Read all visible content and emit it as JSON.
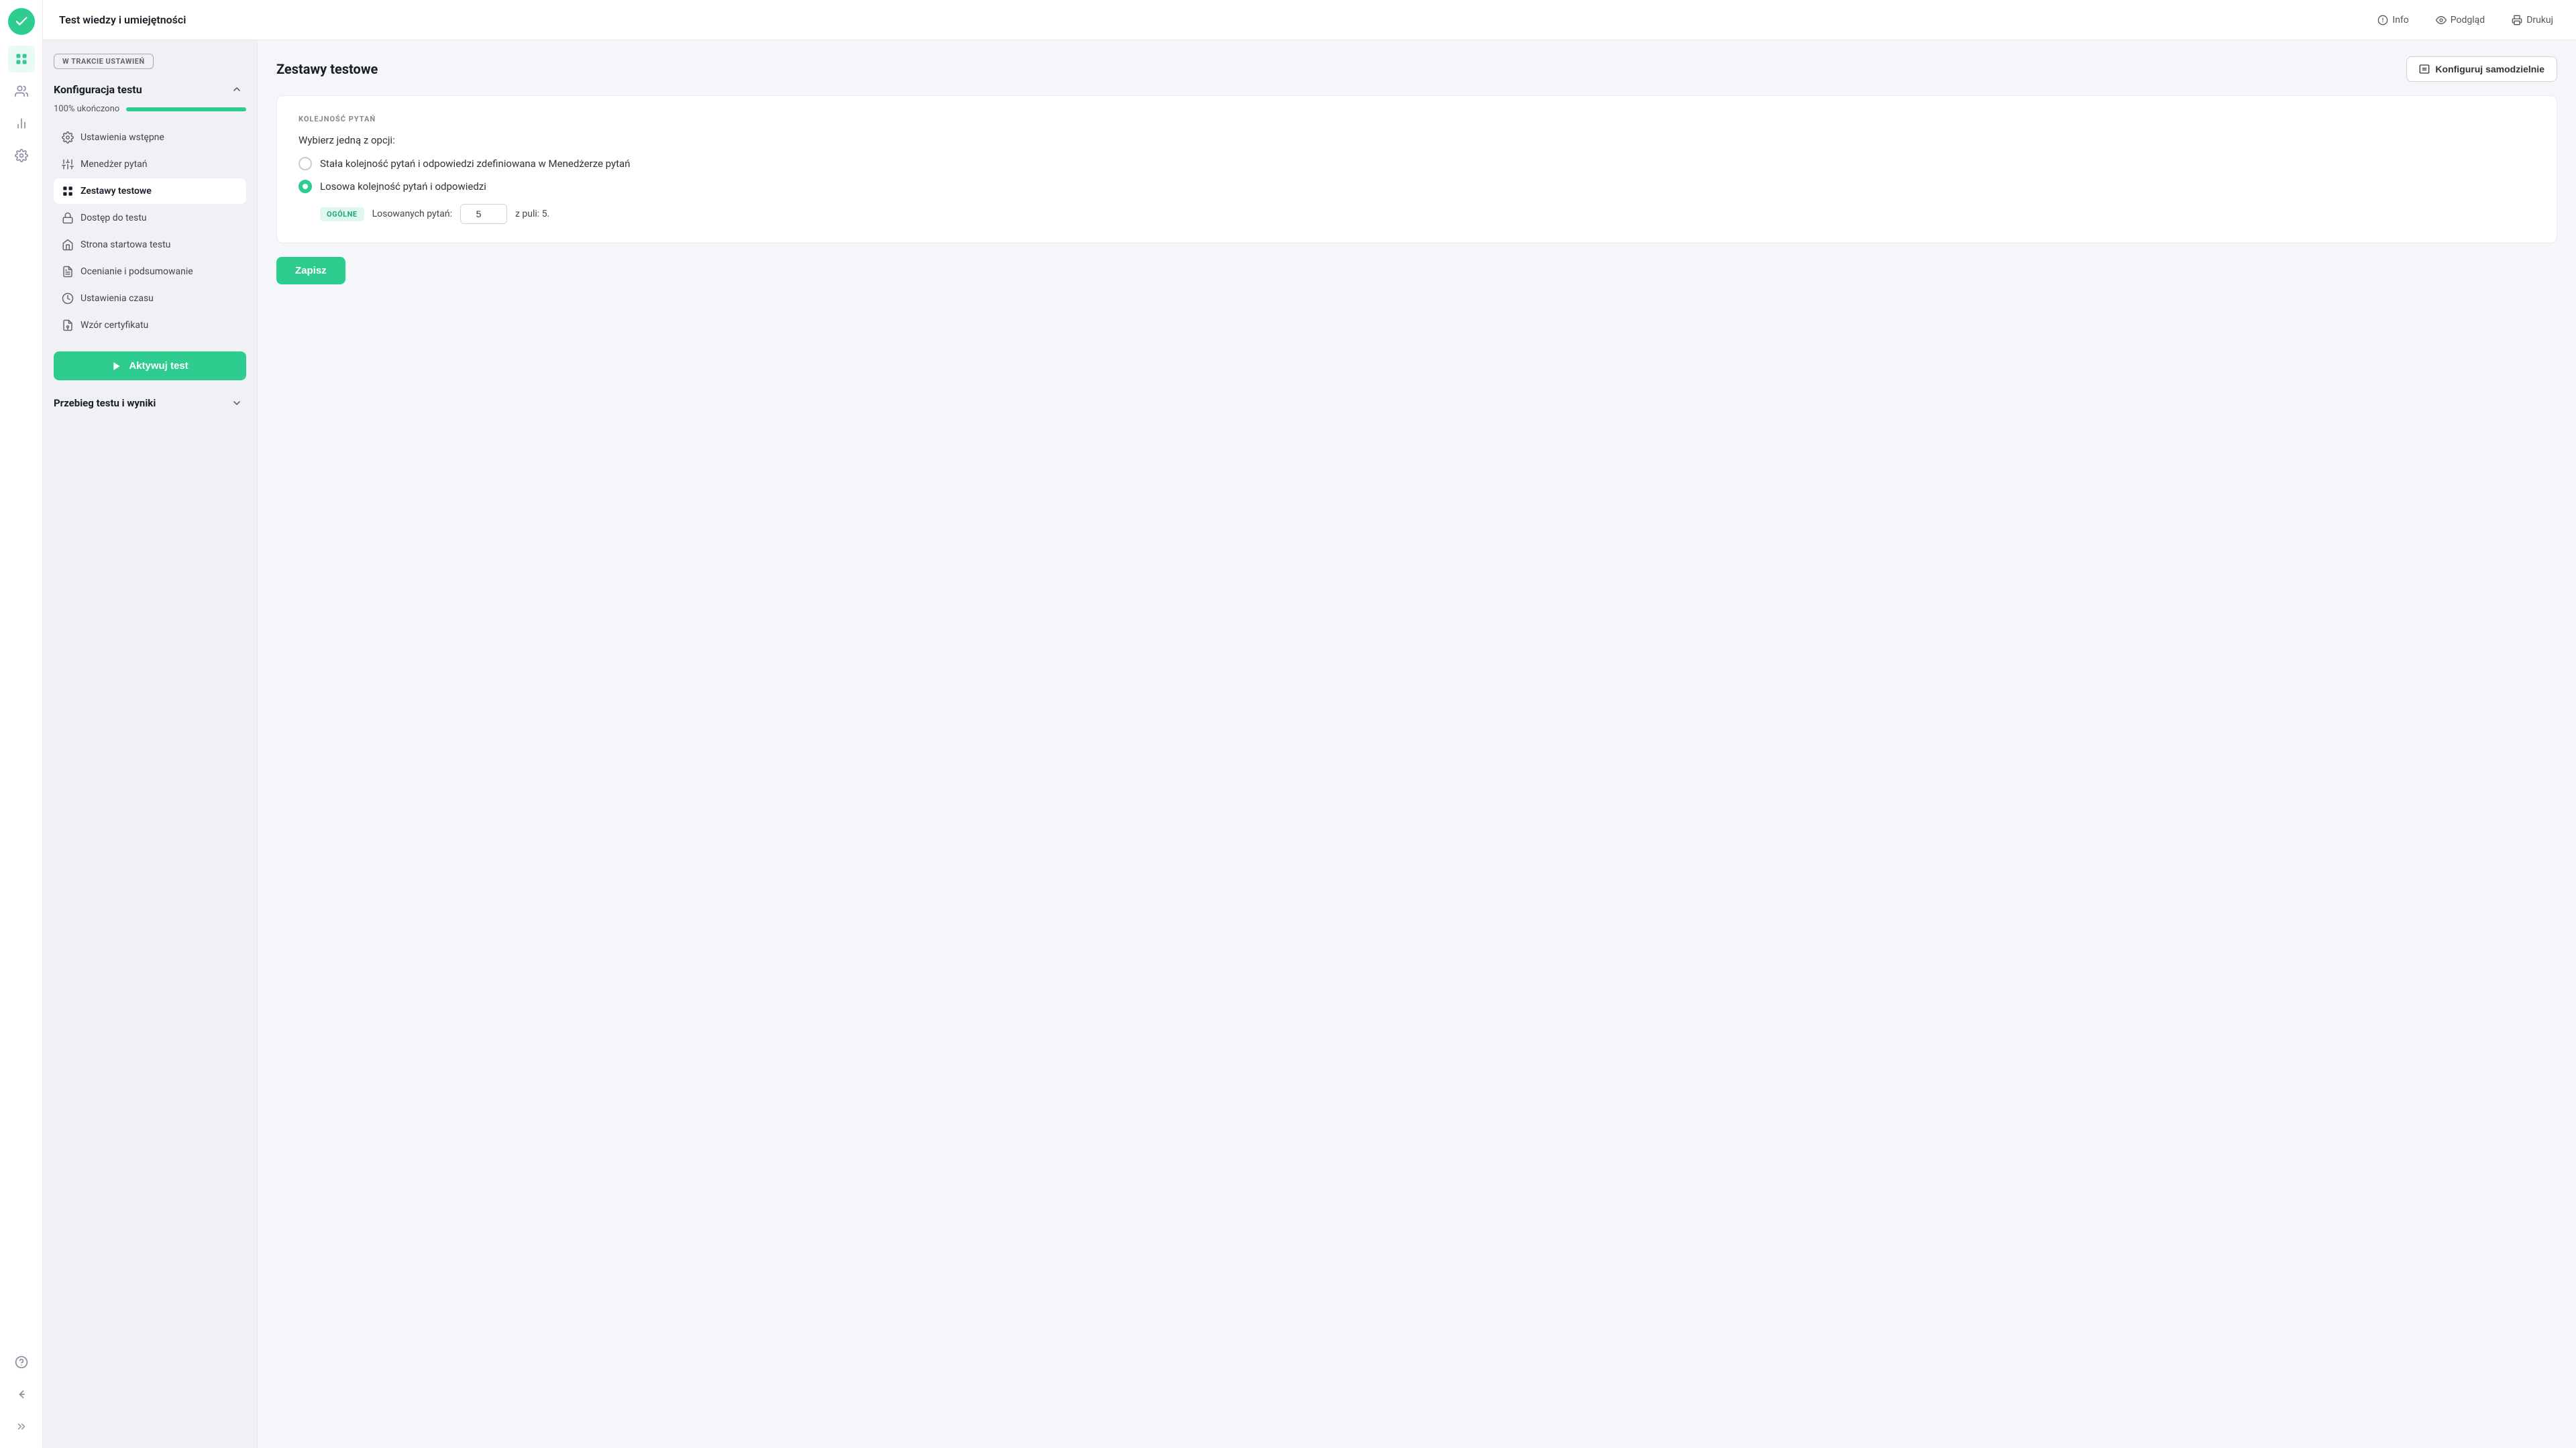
{
  "app": {
    "title": "Test wiedzy i umiejętności"
  },
  "header": {
    "info_label": "Info",
    "preview_label": "Podgląd",
    "print_label": "Drukuj"
  },
  "sidebar": {
    "status_badge": "W TRAKCIE USTAWIEŃ",
    "config_section_title": "Konfiguracja testu",
    "progress_label": "100% ukończono",
    "progress_pct": 100,
    "menu_items": [
      {
        "id": "ustawienia-wstepne",
        "label": "Ustawienia wstępne",
        "icon": "settings-icon"
      },
      {
        "id": "menedzer-pytan",
        "label": "Menedżer pytań",
        "icon": "sliders-icon"
      },
      {
        "id": "zestawy-testowe",
        "label": "Zestawy testowe",
        "icon": "grid-icon",
        "active": true
      },
      {
        "id": "dostep-do-testu",
        "label": "Dostęp do testu",
        "icon": "lock-icon"
      },
      {
        "id": "strona-startowa",
        "label": "Strona startowa testu",
        "icon": "home-icon"
      },
      {
        "id": "ocenianie",
        "label": "Ocenianie i podsumowanie",
        "icon": "doc-icon"
      },
      {
        "id": "ustawienia-czasu",
        "label": "Ustawienia czasu",
        "icon": "clock-icon"
      },
      {
        "id": "wzor-certyfikatu",
        "label": "Wzór certyfikatu",
        "icon": "cert-icon"
      }
    ],
    "activate_btn": "Aktywuj test",
    "results_section_title": "Przebieg testu i wyniki"
  },
  "main": {
    "section_title": "Zestawy testowe",
    "configure_self_label": "Konfiguruj samodzielnie",
    "card": {
      "section_label": "KOLEJNOŚĆ PYTAŃ",
      "choose_label": "Wybierz jedną z opcji:",
      "options": [
        {
          "id": "fixed",
          "label": "Stała kolejność pytań i odpowiedzi zdefiniowana w Menedżerze pytań",
          "selected": false
        },
        {
          "id": "random",
          "label": "Losowa kolejność pytań i odpowiedzi",
          "selected": true
        }
      ],
      "badge_label": "OGÓLNE",
      "losowanych_label": "Losowanych pytań:",
      "losowanych_value": "5",
      "z_puli_text": "z puli: 5."
    },
    "save_label": "Zapisz"
  },
  "nav_icons": [
    {
      "id": "grid-nav",
      "icon": "grid-icon",
      "active": true
    },
    {
      "id": "users-nav",
      "icon": "users-icon",
      "active": false
    },
    {
      "id": "chart-nav",
      "icon": "chart-icon",
      "active": false
    },
    {
      "id": "settings-nav",
      "icon": "settings-icon",
      "active": false
    },
    {
      "id": "help-nav",
      "icon": "help-icon",
      "active": false
    },
    {
      "id": "back-nav",
      "icon": "back-icon",
      "active": false
    },
    {
      "id": "expand-nav",
      "icon": "expand-icon",
      "active": false
    }
  ]
}
